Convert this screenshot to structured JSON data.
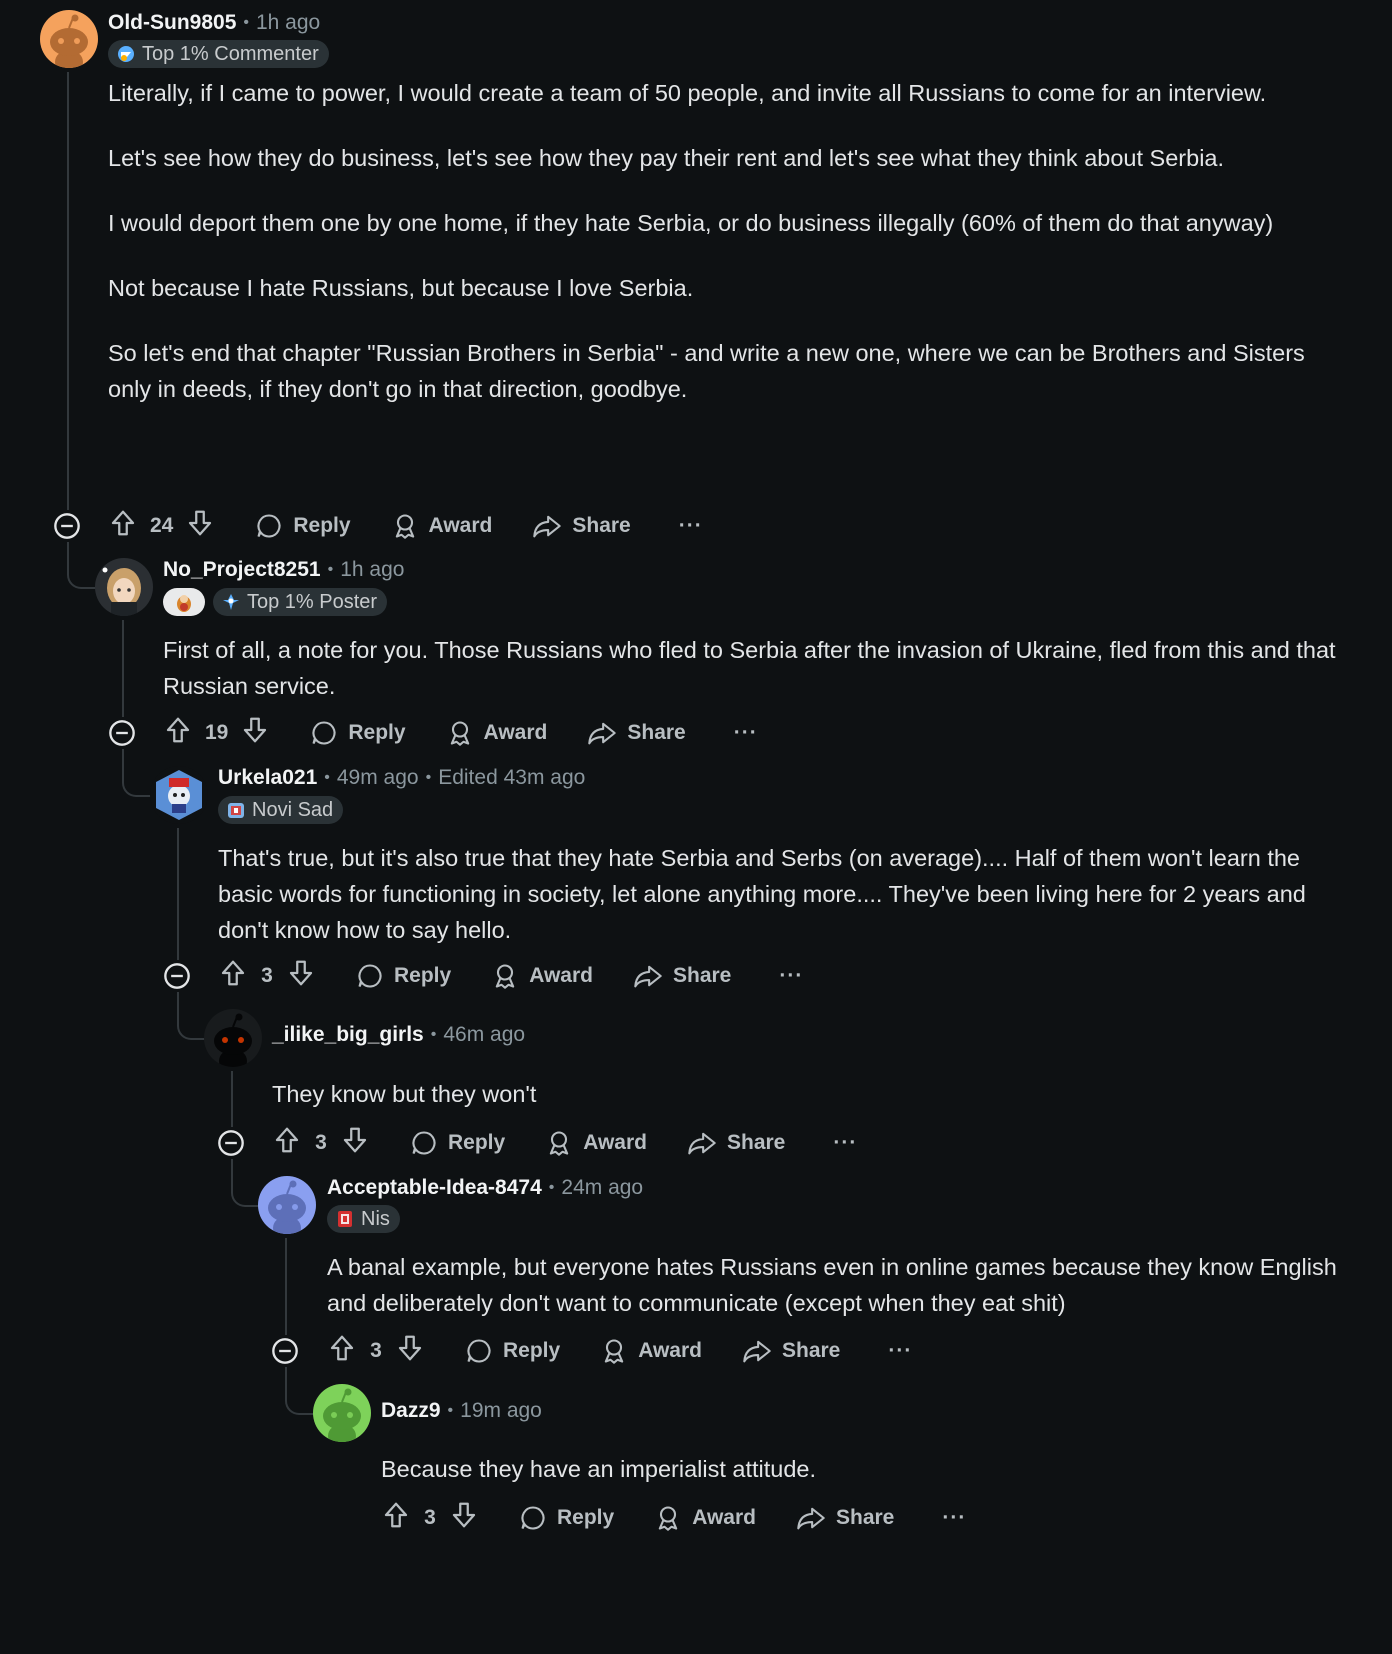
{
  "comments": [
    {
      "author": "Old-Sun9805",
      "time": "1h ago",
      "flair": "Top 1% Commenter",
      "flair_icon": "commenter-badge-icon",
      "paragraphs": [
        "Literally, if I came to power, I would create a team of 50 people, and invite all Russians to come for an interview.",
        "Let's see how they do business, let's see how they pay their rent and let's see what they think about Serbia.",
        "I would deport them one by one home, if they hate Serbia, or do business illegally (60% of them do that anyway)",
        "Not because I hate Russians, but because I love Serbia.",
        "So let's end that chapter \"Russian Brothers in Serbia\" - and write a new one, where we can be Brothers and Sisters only in deeds, if they don't go in that direction, goodbye."
      ],
      "votes": "24",
      "avatar_color": "#f5a25d"
    },
    {
      "author": "No_Project8251",
      "time": "1h ago",
      "flair": "Top 1% Poster",
      "flair_icon": "poster-badge-icon",
      "paragraphs": [
        "First of all, a note for you. Those Russians who fled to Serbia after the invasion of Ukraine, fled from this and that Russian service."
      ],
      "votes": "19"
    },
    {
      "author": "Urkela021",
      "time": "49m ago",
      "edited": "Edited 43m ago",
      "flair": "Novi Sad",
      "flair_icon": "novi-sad-crest-icon",
      "paragraphs": [
        "That's true, but it's also true that they hate Serbia and Serbs (on average).... Half of them won't learn the basic words for functioning in society, let alone anything more.... They've been living here for 2 years and don't know how to say hello."
      ],
      "votes": "3"
    },
    {
      "author": "_ilike_big_girls",
      "time": "46m ago",
      "paragraphs": [
        "They know but they won't"
      ],
      "votes": "3"
    },
    {
      "author": "Acceptable-Idea-8474",
      "time": "24m ago",
      "flair": "Nis",
      "flair_icon": "nis-crest-icon",
      "paragraphs": [
        "A banal example, but everyone hates Russians even in online games because they know English and deliberately don't want to communicate (except when they eat shit)"
      ],
      "votes": "3",
      "avatar_color": "#8a9ff0"
    },
    {
      "author": "Dazz9",
      "time": "19m ago",
      "paragraphs": [
        "Because they have an imperialist attitude."
      ],
      "votes": "3",
      "avatar_color": "#7ed25a"
    }
  ],
  "labels": {
    "reply": "Reply",
    "award": "Award",
    "share": "Share",
    "more": "···",
    "sep": "•"
  }
}
